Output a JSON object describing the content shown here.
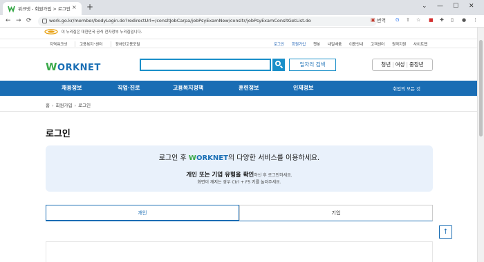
{
  "browser": {
    "tab_title": "워크넷 - 회원가입 > 로그인",
    "tab_close": "×",
    "new_tab": "+",
    "url": "work.go.kr/member/bodyLogin.do?redirectUrl=/consltJobCarpa/jobPsyExamNew/consltr/jobPsyExamConsltGetList.do",
    "translate_label": "번역",
    "window_controls": [
      "⌄",
      "—",
      "☐",
      "✕"
    ]
  },
  "gov_notice": "이 누리집은 대한민국 공식 전자정부 누리집입니다.",
  "util_left": [
    "지역워크넷",
    "고용복지⁺센터",
    "장애인고용포털"
  ],
  "util_right": [
    "로그인",
    "회원가입",
    "챗봇",
    "내일배움",
    "이용안내",
    "고객센터",
    "원격지원",
    "사이트맵"
  ],
  "brand": {
    "w": "W",
    "rest": "ORKNET"
  },
  "search": {
    "placeholder": "",
    "job_search_label": "일자리 검색"
  },
  "segments": {
    "a": "청년",
    "b": "여성",
    "c": "중장년",
    "divider": "|"
  },
  "gnb": [
    "채용정보",
    "직업·진로",
    "고용복지정책",
    "훈련정보",
    "인재정보"
  ],
  "gnb_all": "취업의 모든 것",
  "breadcrumb": {
    "home": "홈",
    "arrow": "›",
    "level1": "회원가입",
    "level2": "로그인"
  },
  "page_title": "로그인",
  "info": {
    "line1_pre": "로그인 후 ",
    "line1_brand_w": "W",
    "line1_brand_rest": "ORKNET",
    "line1_post": "의 다양한 서비스를 이용하세요.",
    "line2_bold": "개인 또는 기업 유형을 확인",
    "line2_small": "하신 후 로그인하세요.",
    "line3": "화면이 깨지는 경우 Ctrl + F5 키를 눌러주세요."
  },
  "tabs": {
    "personal": "개인",
    "company": "기업"
  },
  "top_button": "↑",
  "colors": {
    "brand_blue": "#1a6db4",
    "brand_green": "#3aa94a",
    "info_bg": "#e9f1fb"
  }
}
